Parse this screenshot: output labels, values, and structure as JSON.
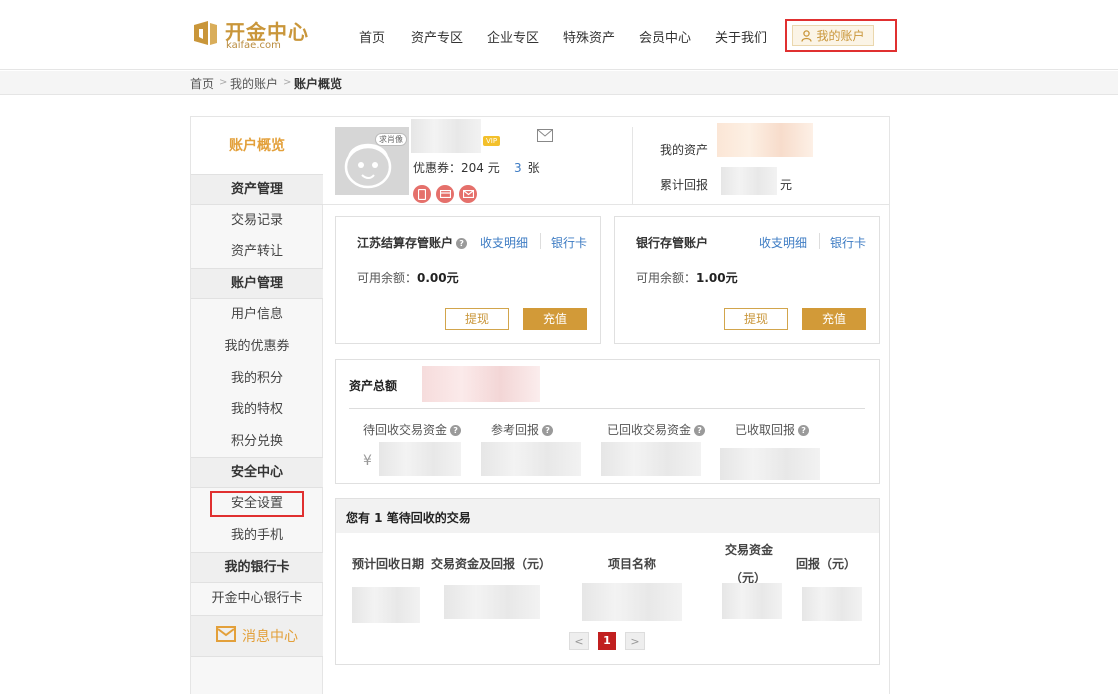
{
  "header": {
    "logo_cn": "开金中心",
    "logo_en": "kaifae.com",
    "nav": [
      "首页",
      "资产专区",
      "企业专区",
      "特殊资产",
      "会员中心",
      "关于我们"
    ],
    "account_button": "我的账户"
  },
  "breadcrumb": {
    "items": [
      "首页",
      "我的账户",
      "账户概览"
    ],
    "separator": ">"
  },
  "sidebar": {
    "title": "账户概览",
    "sections": [
      {
        "title": "资产管理",
        "items": [
          "交易记录",
          "资产转让"
        ]
      },
      {
        "title": "账户管理",
        "items": [
          "用户信息",
          "我的优惠券",
          "我的积分",
          "我的特权",
          "积分兑换"
        ]
      },
      {
        "title": "安全中心",
        "items": [
          "安全设置",
          "我的手机"
        ]
      },
      {
        "title": "我的银行卡",
        "items": [
          "开金中心银行卡"
        ]
      }
    ],
    "message_center": "消息中心"
  },
  "profile": {
    "avatar_tag": "求肖像",
    "coupon_label": "优惠券：204 元",
    "coupon_count": "3",
    "coupon_unit": "张",
    "my_assets_label": "我的资产",
    "cumulative_return_label": "累计回报",
    "cumulative_return_unit": "元"
  },
  "accounts": [
    {
      "title": "江苏结算存管账户",
      "link1": "收支明细",
      "link2": "银行卡",
      "balance_label": "可用余额：",
      "balance_value": "0.00元",
      "withdraw": "提现",
      "deposit": "充值"
    },
    {
      "title": "银行存管账户",
      "link1": "收支明细",
      "link2": "银行卡",
      "balance_label": "可用余额：",
      "balance_value": "1.00元",
      "withdraw": "提现",
      "deposit": "充值"
    }
  ],
  "totals": {
    "title": "资产总额",
    "columns": [
      "待回收交易资金",
      "参考回报",
      "已回收交易资金",
      "已收取回报"
    ],
    "currency_symbol": "¥"
  },
  "pending": {
    "title": "您有 1 笔待回收的交易",
    "headers": [
      "预计回收日期",
      "交易资金及回报（元）",
      "项目名称",
      "交易资金",
      "（元）",
      "回报（元）"
    ],
    "pager": {
      "prev": "<",
      "current": "1",
      "next": ">"
    }
  },
  "colors": {
    "brand_gold": "#c9963a",
    "sidebar_title": "#e3a03a",
    "link_blue": "#3c7bc3",
    "highlight_red": "#e03030",
    "page_active": "#c11f1f"
  }
}
